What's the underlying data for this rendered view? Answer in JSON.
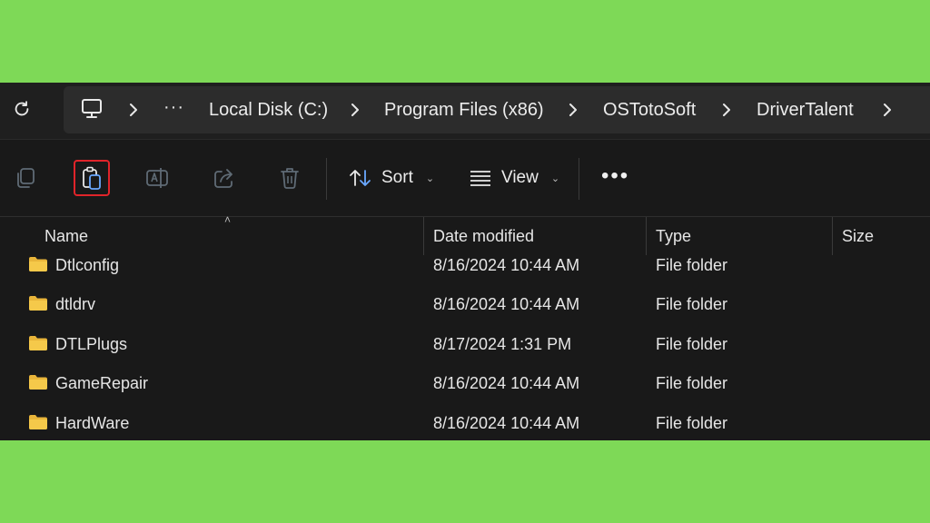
{
  "breadcrumb": {
    "items": [
      "Local Disk (C:)",
      "Program Files (x86)",
      "OSTotoSoft",
      "DriverTalent"
    ],
    "overflow": "···"
  },
  "toolbar": {
    "sort_label": "Sort",
    "view_label": "View",
    "more_label": "•••"
  },
  "columns": [
    "Name",
    "Date modified",
    "Type",
    "Size"
  ],
  "files": [
    {
      "name": "Dtlconfig",
      "date": "8/16/2024 10:44 AM",
      "type": "File folder"
    },
    {
      "name": "dtldrv",
      "date": "8/16/2024 10:44 AM",
      "type": "File folder"
    },
    {
      "name": "DTLPlugs",
      "date": "8/17/2024 1:31 PM",
      "type": "File folder"
    },
    {
      "name": "GameRepair",
      "date": "8/16/2024 10:44 AM",
      "type": "File folder"
    },
    {
      "name": "HardWare",
      "date": "8/16/2024 10:44 AM",
      "type": "File folder"
    }
  ],
  "colors": {
    "background": "#7ed957",
    "window": "#191919",
    "highlight": "#e0242a",
    "folder": "#f5c94a",
    "accent": "#6aa8ff"
  },
  "icons": {
    "refresh": "refresh-icon",
    "computer": "computer-icon",
    "copy": "copy-icon",
    "paste": "paste-icon",
    "rename": "rename-icon",
    "share": "share-icon",
    "delete": "delete-icon",
    "sort": "sort-icon",
    "view": "view-icon",
    "folder": "folder-icon"
  }
}
